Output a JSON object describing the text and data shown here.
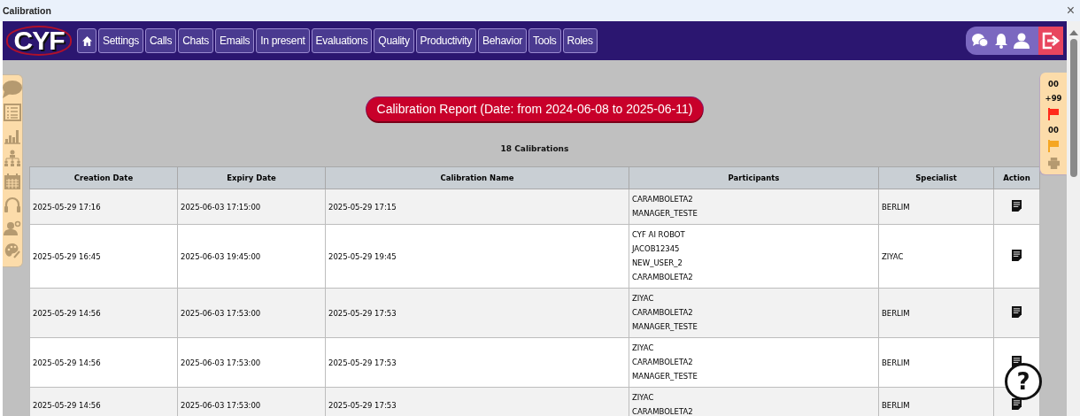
{
  "window": {
    "title": "Calibration",
    "close": "×"
  },
  "nav": {
    "logo": "CYF",
    "items": [
      {
        "kind": "home"
      },
      {
        "kind": "text",
        "label": "Settings"
      },
      {
        "kind": "text",
        "label": "Calls"
      },
      {
        "kind": "text",
        "label": "Chats"
      },
      {
        "kind": "text",
        "label": "Emails"
      },
      {
        "kind": "text",
        "label": "In present"
      },
      {
        "kind": "text",
        "label": "Evaluations"
      },
      {
        "kind": "text",
        "label": "Quality"
      },
      {
        "kind": "text",
        "label": "Productivity"
      },
      {
        "kind": "text",
        "label": "Behavior"
      },
      {
        "kind": "text",
        "label": "Tools"
      },
      {
        "kind": "text",
        "label": "Roles"
      }
    ]
  },
  "counters": [
    {
      "kind": "text",
      "text": "00"
    },
    {
      "kind": "text",
      "text": "+99"
    },
    {
      "kind": "flag",
      "color": "#ff2a1a"
    },
    {
      "kind": "text",
      "text": "00"
    },
    {
      "kind": "flag",
      "color": "#f5a623"
    },
    {
      "kind": "print"
    }
  ],
  "report": {
    "title": "Calibration Report (Date: from 2024-06-08 to 2025-06-11)",
    "count": "18 Calibrations"
  },
  "table": {
    "columns": [
      "Creation Date",
      "Expiry Date",
      "Calibration Name",
      "Participants",
      "Specialist",
      "Action"
    ],
    "rows": [
      {
        "creation": "2025-05-29 17:16",
        "expiry": "2025-06-03 17:15:00",
        "name": "2025-05-29 17:15",
        "participants": [
          "CARAMBOLETA2",
          "MANAGER_TESTE"
        ],
        "specialist": "BERLIM"
      },
      {
        "creation": "2025-05-29 16:45",
        "expiry": "2025-06-03 19:45:00",
        "name": "2025-05-29 19:45",
        "participants": [
          "CYF AI ROBOT",
          "JACOB12345",
          "NEW_USER_2",
          "CARAMBOLETA2"
        ],
        "specialist": "ZIYAC"
      },
      {
        "creation": "2025-05-29 14:56",
        "expiry": "2025-06-03 17:53:00",
        "name": "2025-05-29 17:53",
        "participants": [
          "ZIYAC",
          "CARAMBOLETA2",
          "MANAGER_TESTE"
        ],
        "specialist": "BERLIM"
      },
      {
        "creation": "2025-05-29 14:56",
        "expiry": "2025-06-03 17:53:00",
        "name": "2025-05-29 17:53",
        "participants": [
          "ZIYAC",
          "CARAMBOLETA2",
          "MANAGER_TESTE"
        ],
        "specialist": "BERLIM"
      },
      {
        "creation": "2025-05-29 14:56",
        "expiry": "2025-06-03 17:53:00",
        "name": "2025-05-29 17:53",
        "participants": [
          "ZIYAC",
          "CARAMBOLETA2"
        ],
        "specialist": "BERLIM"
      }
    ]
  },
  "help": "?"
}
